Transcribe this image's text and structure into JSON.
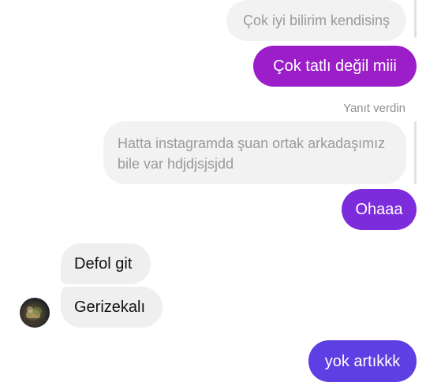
{
  "messages": {
    "quoted_top": "Çok iyi bilirim kendisinş",
    "sent_1": "Çok tatlı değil miii",
    "reply_note": "Yanıt verdin",
    "quoted_mid": "Hatta instagramda şuan ortak arkadaşımız bile var hdjdjsjsjdd",
    "sent_2": "Ohaaa",
    "received_1": "Defol git",
    "received_2": "Gerizekalı",
    "sent_3": "yok artıkkk"
  },
  "colors": {
    "sent_1": "#9b1ec8",
    "sent_2": "#7d2cdc",
    "sent_3": "#5d3fe3",
    "received_bg": "#efefef",
    "quoted_bg": "#f2f2f2",
    "background": "#ffffff"
  },
  "icons": {
    "avatar": "contact-avatar"
  }
}
